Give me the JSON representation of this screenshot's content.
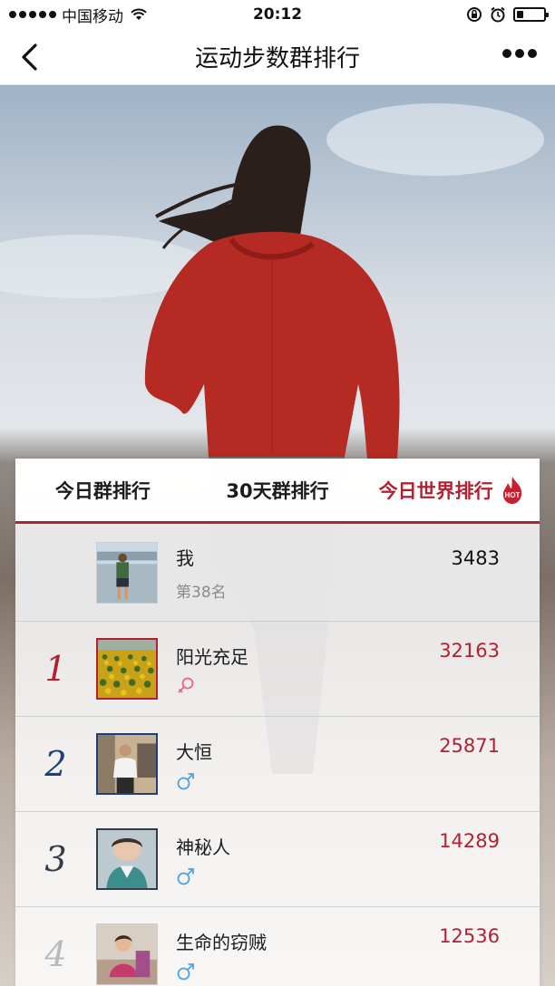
{
  "status_bar": {
    "carrier": "中国移动",
    "time": "20:12",
    "battery_level": 0.25
  },
  "nav": {
    "title": "运动步数群排行",
    "back_icon": "chevron-left-icon",
    "more_icon": "more-dots-icon"
  },
  "tabs": [
    {
      "label": "今日群排行",
      "active": false
    },
    {
      "label": "30天群排行",
      "active": false
    },
    {
      "label": "今日世界排行",
      "active": true,
      "badge": "HOT"
    }
  ],
  "me": {
    "name": "我",
    "rank_text": "第38名",
    "steps": "3483"
  },
  "ranking": [
    {
      "rank": "1",
      "name": "阳光充足",
      "gender": "female-icon",
      "steps": "32163"
    },
    {
      "rank": "2",
      "name": "大恒",
      "gender": "male-icon",
      "steps": "25871"
    },
    {
      "rank": "3",
      "name": "神秘人",
      "gender": "male-icon",
      "steps": "14289"
    },
    {
      "rank": "4",
      "name": "生命的窃贼",
      "gender": "male-icon",
      "steps": "12536"
    }
  ],
  "colors": {
    "accent": "#b32032",
    "rank2": "#1d3f7a",
    "female": "#e7638e",
    "male": "#4da3e0"
  }
}
